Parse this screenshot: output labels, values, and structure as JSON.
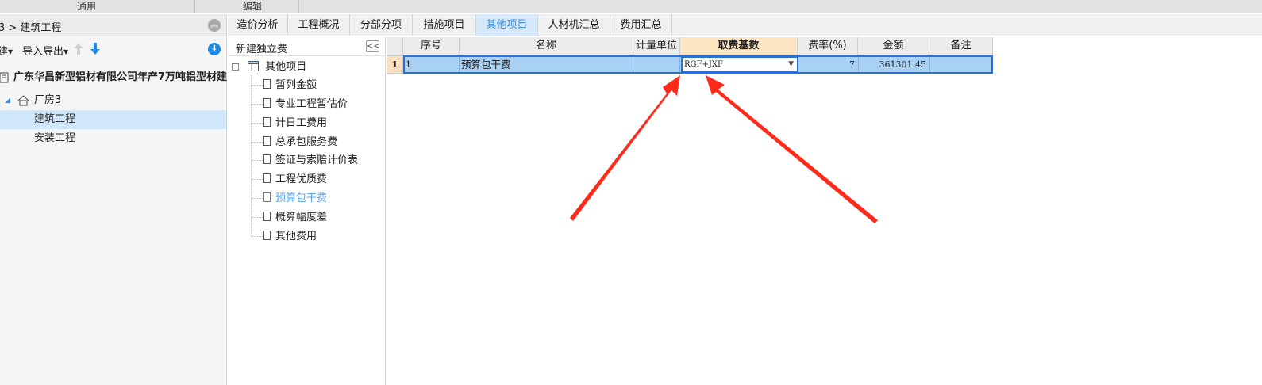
{
  "ribbon": {
    "group1": "通用",
    "group2": "编辑"
  },
  "left": {
    "breadcrumb": "3 > 建筑工程",
    "toolbar": {
      "new": "建",
      "import_export": "导入导出"
    },
    "tree": {
      "project": "广东华昌新型铝材有限公司年产7万吨铝型材建...",
      "building": "厂房3",
      "item1": "建筑工程",
      "item2": "安装工程"
    }
  },
  "tabs": [
    "造价分析",
    "工程概况",
    "分部分项",
    "措施项目",
    "其他项目",
    "人材机汇总",
    "费用汇总"
  ],
  "active_tab_index": 4,
  "mid": {
    "header": "新建独立费",
    "root": "其他项目",
    "items": [
      "暂列金额",
      "专业工程暂估价",
      "计日工费用",
      "总承包服务费",
      "签证与索赔计价表",
      "工程优质费",
      "预算包干费",
      "概算幅度差",
      "其他费用"
    ],
    "selected_index": 6
  },
  "grid": {
    "headers": [
      "序号",
      "名称",
      "计量单位",
      "取费基数",
      "费率(%)",
      "金额",
      "备注"
    ],
    "rows": [
      {
        "num": "1",
        "seq": "1",
        "name": "预算包干费",
        "unit": "",
        "base": "RGF+JXF",
        "rate": "7",
        "amount": "361301.45",
        "remark": ""
      }
    ]
  },
  "colors": {
    "accent": "#3d8fe0",
    "selection": "#a9d1f5",
    "highlight_header": "#fde5c2",
    "arrow": "#ff2a1a"
  }
}
